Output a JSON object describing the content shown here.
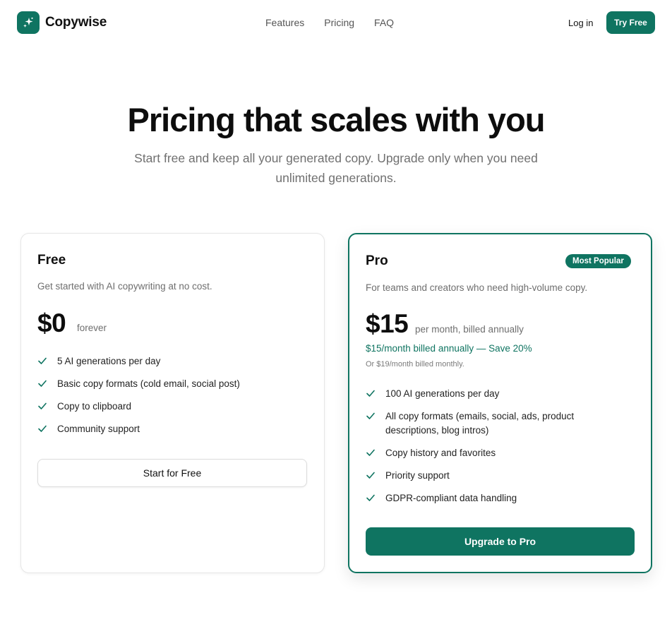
{
  "nav": {
    "brand": "Copywise",
    "links": [
      "Features",
      "Pricing",
      "FAQ"
    ],
    "login": "Log in",
    "cta": "Try Free"
  },
  "hero": {
    "title": "Pricing that scales with you",
    "subtitle": "Start free and keep all your generated copy. Upgrade only when you need unlimited generations."
  },
  "plans": {
    "free": {
      "name": "Free",
      "description": "Get started with AI copywriting at no cost.",
      "price": "$0",
      "price_note": "forever",
      "features": [
        "5 AI generations per day",
        "Basic copy formats (cold email, social post)",
        "Copy to clipboard",
        "Community support"
      ],
      "button": "Start for Free"
    },
    "pro": {
      "name": "Pro",
      "badge": "Most Popular",
      "description": "For teams and creators who need high-volume copy.",
      "price": "$15",
      "price_note": "per month, billed annually",
      "savings": "$15/month billed annually — Save 20%",
      "monthly_note": "Or $19/month billed monthly.",
      "features": [
        "100 AI generations per day",
        "All copy formats (emails, social, ads, product descriptions, blog intros)",
        "Copy history and favorites",
        "Priority support",
        "GDPR-compliant data handling"
      ],
      "button": "Upgrade to Pro"
    }
  },
  "icons": {
    "logo": "sparkles-icon",
    "feature_bullet": "check-icon"
  },
  "colors": {
    "brand": "#0f7461",
    "text": "#111111",
    "muted": "#6e6e6e"
  }
}
